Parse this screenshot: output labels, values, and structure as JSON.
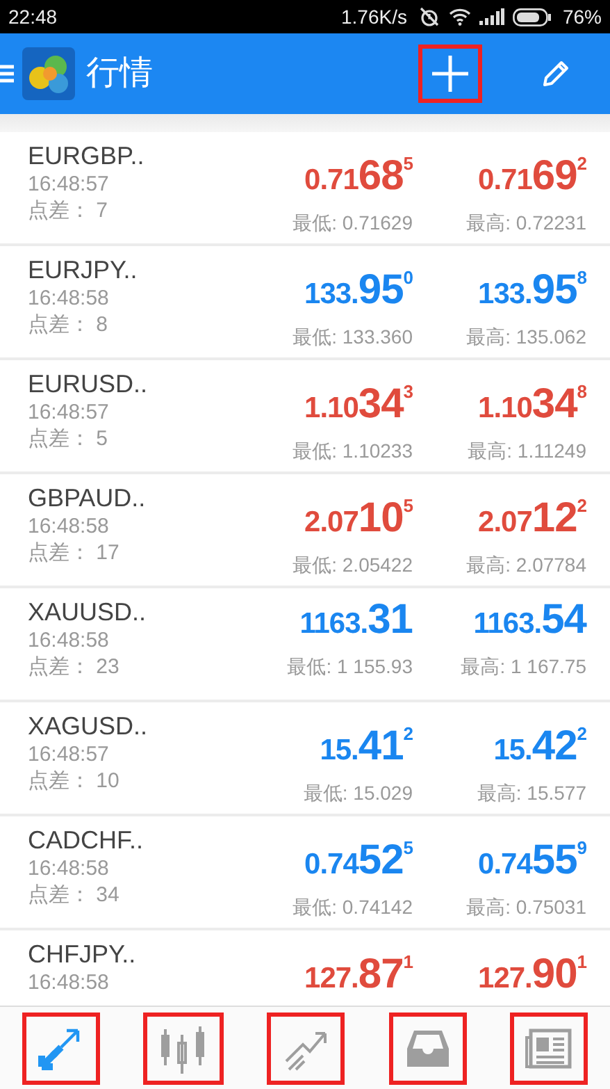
{
  "status_bar": {
    "time": "22:48",
    "speed": "1.76K/s",
    "battery": "76%"
  },
  "app_bar": {
    "title": "行情",
    "actions": [
      {
        "kind": "add",
        "highlighted": true
      },
      {
        "kind": "edit",
        "highlighted": false
      }
    ]
  },
  "quotes": [
    {
      "symbol": "EURGBP..",
      "time": "16:48:57",
      "spread": "点差： 7",
      "color": "#e04b3d",
      "bid": {
        "prefix": "0.71",
        "big": "68",
        "sup": "5"
      },
      "ask": {
        "prefix": "0.71",
        "big": "69",
        "sup": "2"
      },
      "low": "最低: 0.71629",
      "high": "最高: 0.72231"
    },
    {
      "symbol": "EURJPY..",
      "time": "16:48:58",
      "spread": "点差： 8",
      "color": "#1a86f0",
      "bid": {
        "prefix": "133.",
        "big": "95",
        "sup": "0"
      },
      "ask": {
        "prefix": "133.",
        "big": "95",
        "sup": "8"
      },
      "low": "最低: 133.360",
      "high": "最高: 135.062"
    },
    {
      "symbol": "EURUSD..",
      "time": "16:48:57",
      "spread": "点差： 5",
      "color": "#e04b3d",
      "bid": {
        "prefix": "1.10",
        "big": "34",
        "sup": "3"
      },
      "ask": {
        "prefix": "1.10",
        "big": "34",
        "sup": "8"
      },
      "low": "最低: 1.10233",
      "high": "最高: 1.11249"
    },
    {
      "symbol": "GBPAUD..",
      "time": "16:48:58",
      "spread": "点差： 17",
      "color": "#e04b3d",
      "bid": {
        "prefix": "2.07",
        "big": "10",
        "sup": "5"
      },
      "ask": {
        "prefix": "2.07",
        "big": "12",
        "sup": "2"
      },
      "low": "最低: 2.05422",
      "high": "最高: 2.07784"
    },
    {
      "symbol": "XAUUSD..",
      "time": "16:48:58",
      "spread": "点差： 23",
      "color": "#1a86f0",
      "bid": {
        "prefix": "1163.",
        "big": "31"
      },
      "ask": {
        "prefix": "1163.",
        "big": "54"
      },
      "low": "最低: 1 155.93",
      "high": "最高: 1 167.75"
    },
    {
      "symbol": "XAGUSD..",
      "time": "16:48:57",
      "spread": "点差： 10",
      "color": "#1a86f0",
      "bid": {
        "prefix": "15.",
        "big": "41",
        "sup": "2"
      },
      "ask": {
        "prefix": "15.",
        "big": "42",
        "sup": "2"
      },
      "low": "最低: 15.029",
      "high": "最高: 15.577"
    },
    {
      "symbol": "CADCHF..",
      "time": "16:48:58",
      "spread": "点差： 34",
      "color": "#1a86f0",
      "bid": {
        "prefix": "0.74",
        "big": "52",
        "sup": "5"
      },
      "ask": {
        "prefix": "0.74",
        "big": "55",
        "sup": "9"
      },
      "low": "最低: 0.74142",
      "high": "最高: 0.75031"
    },
    {
      "symbol": "CHFJPY..",
      "time": "16:48:58",
      "color": "#e04b3d",
      "bid": {
        "prefix": "127.",
        "big": "87",
        "sup": "1"
      },
      "ask": {
        "prefix": "127.",
        "big": "90",
        "sup": "1"
      }
    }
  ],
  "bottom_nav": [
    {
      "kind": "quotes",
      "selected": true,
      "highlighted": true
    },
    {
      "kind": "candles",
      "selected": false,
      "highlighted": true
    },
    {
      "kind": "trend",
      "selected": false,
      "highlighted": true
    },
    {
      "kind": "inbox",
      "selected": false,
      "highlighted": true
    },
    {
      "kind": "news",
      "selected": false,
      "highlighted": true
    }
  ]
}
